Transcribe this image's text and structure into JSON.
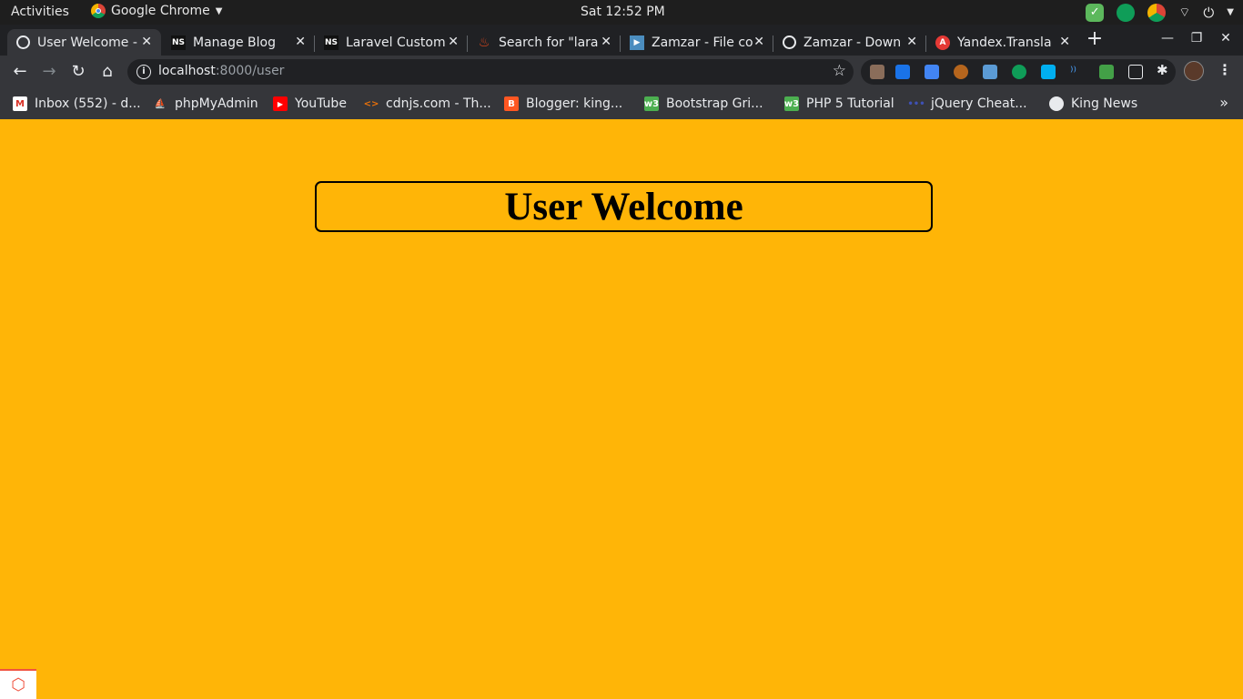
{
  "system": {
    "activities": "Activities",
    "app_name": "Google Chrome",
    "clock": "Sat 12:52 PM"
  },
  "tabs": [
    {
      "title": "User Welcome - ",
      "icon": "globe-icon",
      "active": true
    },
    {
      "title": "Manage Blog",
      "icon": "ns-icon",
      "active": false
    },
    {
      "title": "Laravel Custom",
      "icon": "ns-icon",
      "active": false
    },
    {
      "title": "Search for \"lara",
      "icon": "flame-icon",
      "active": false
    },
    {
      "title": "Zamzar - File co",
      "icon": "zamzar-icon",
      "active": false
    },
    {
      "title": "Zamzar - Down",
      "icon": "globe-icon",
      "active": false
    },
    {
      "title": "Yandex.Transla",
      "icon": "translate-icon",
      "active": false
    }
  ],
  "address_bar": {
    "host": "localhost",
    "path": ":8000/user"
  },
  "bookmarks": [
    {
      "label": "Inbox (552) - d...",
      "icon": "gmail-icon",
      "color": "#d93025"
    },
    {
      "label": "phpMyAdmin",
      "icon": "phpmyadmin-icon",
      "color": "#f29111"
    },
    {
      "label": "YouTube",
      "icon": "youtube-icon",
      "color": "#ff0000"
    },
    {
      "label": "cdnjs.com - Th...",
      "icon": "code-icon",
      "color": "#e8710a"
    },
    {
      "label": "Blogger: king...",
      "icon": "blogger-icon",
      "color": "#ff5722"
    },
    {
      "label": "Bootstrap Gri...",
      "icon": "w3-icon",
      "color": "#4caf50"
    },
    {
      "label": "PHP 5 Tutorial",
      "icon": "w3-icon",
      "color": "#4caf50"
    },
    {
      "label": "jQuery Cheat...",
      "icon": "dots-icon",
      "color": "#1a237e"
    },
    {
      "label": "King News",
      "icon": "globe-icon",
      "color": "#e8eaed"
    }
  ],
  "page": {
    "heading": "User Welcome",
    "background": "#ffb507"
  }
}
